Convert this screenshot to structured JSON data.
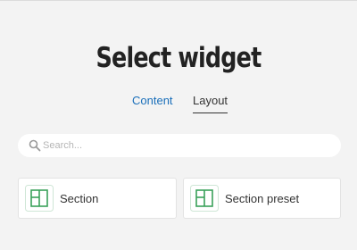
{
  "header": {
    "title": "Select widget"
  },
  "tabs": [
    {
      "label": "Content",
      "active": false
    },
    {
      "label": "Layout",
      "active": true
    }
  ],
  "search": {
    "placeholder": "Search...",
    "value": "",
    "icon": "search-icon"
  },
  "widgets": [
    {
      "label": "Section",
      "icon": "section-icon"
    },
    {
      "label": "Section preset",
      "icon": "section-preset-icon"
    }
  ],
  "colors": {
    "background": "#f3f3f3",
    "accent_blue": "#1a6fba",
    "icon_green": "#3aa15a",
    "text": "#333333"
  }
}
